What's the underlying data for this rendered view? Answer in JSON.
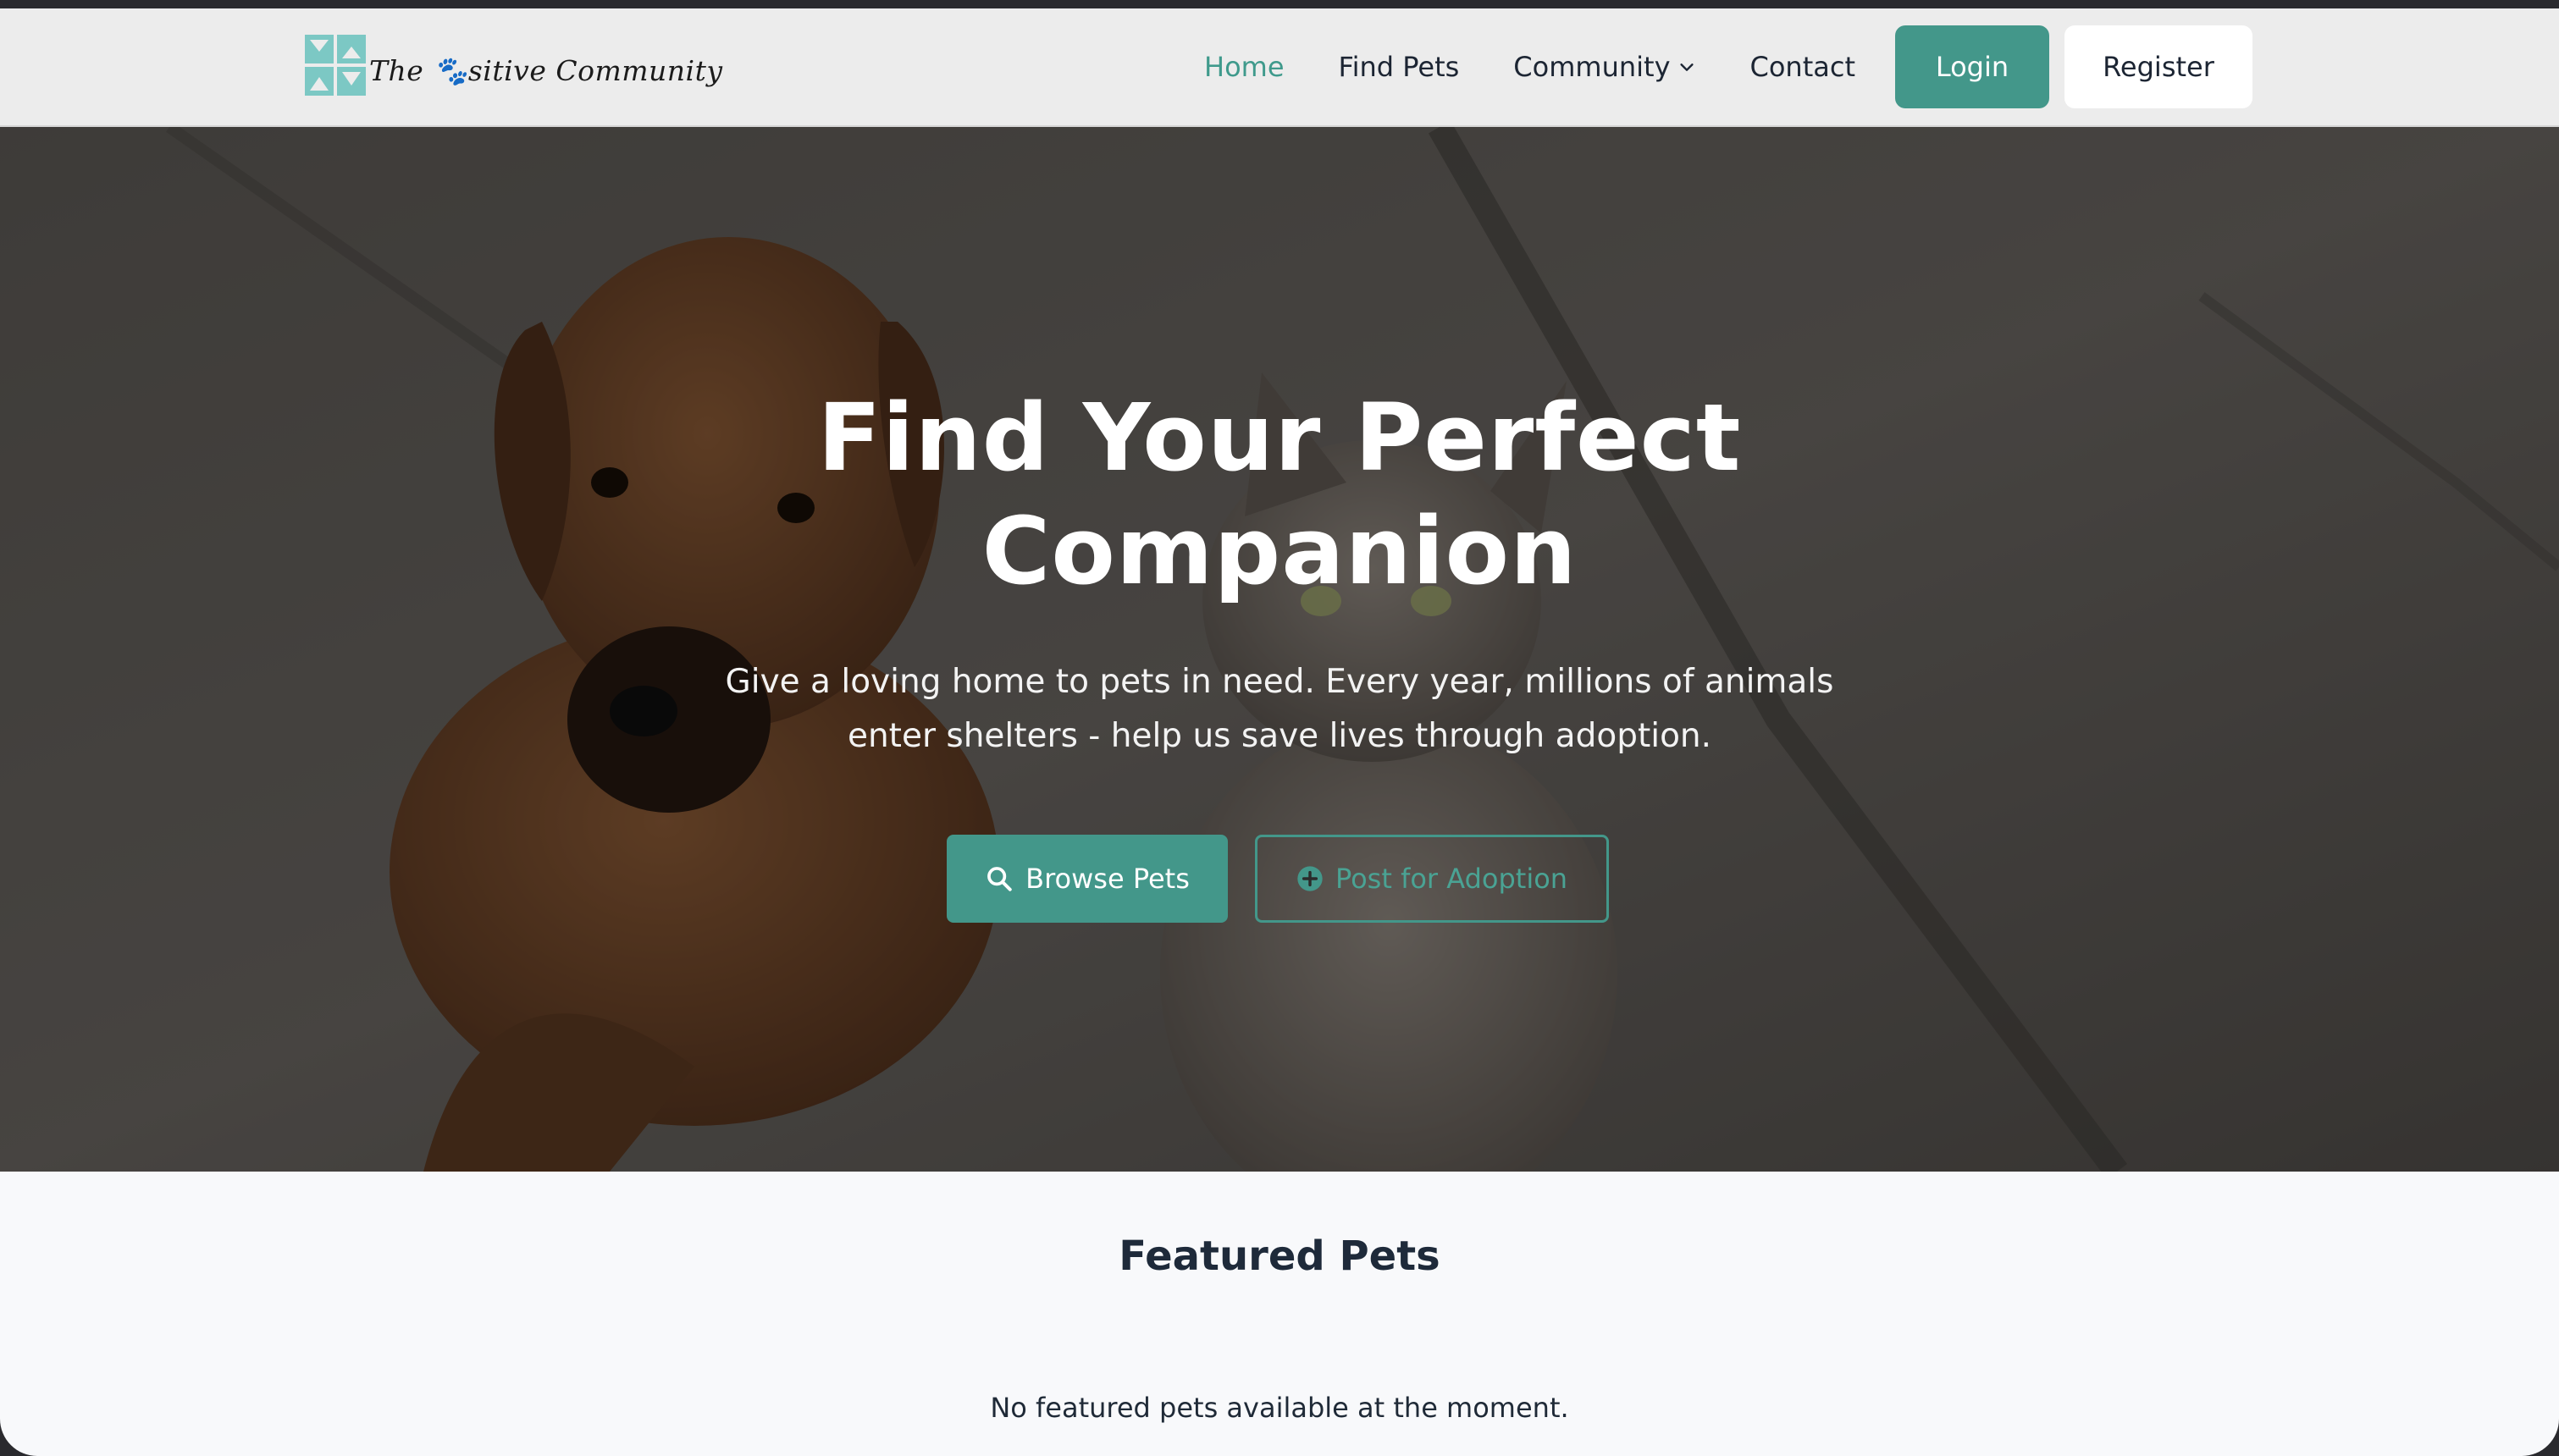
{
  "brand": {
    "logo_text": "The 🐾sitive Community",
    "accent_color": "#43978a",
    "logo_color": "#7cc8c4"
  },
  "nav": {
    "links": [
      {
        "label": "Home",
        "active": true
      },
      {
        "label": "Find Pets",
        "active": false
      },
      {
        "label": "Community",
        "active": false,
        "dropdown": true
      },
      {
        "label": "Contact",
        "active": false
      }
    ],
    "login_label": "Login",
    "register_label": "Register"
  },
  "hero": {
    "title": "Find Your Perfect Companion",
    "subtitle": "Give a loving home to pets in need. Every year, millions of animals enter shelters - help us save lives through adoption.",
    "browse_label": "Browse Pets",
    "browse_icon": "search-icon",
    "post_label": "Post for Adoption",
    "post_icon": "plus-circle-icon"
  },
  "featured": {
    "title": "Featured Pets",
    "empty_message": "No featured pets available at the moment."
  }
}
